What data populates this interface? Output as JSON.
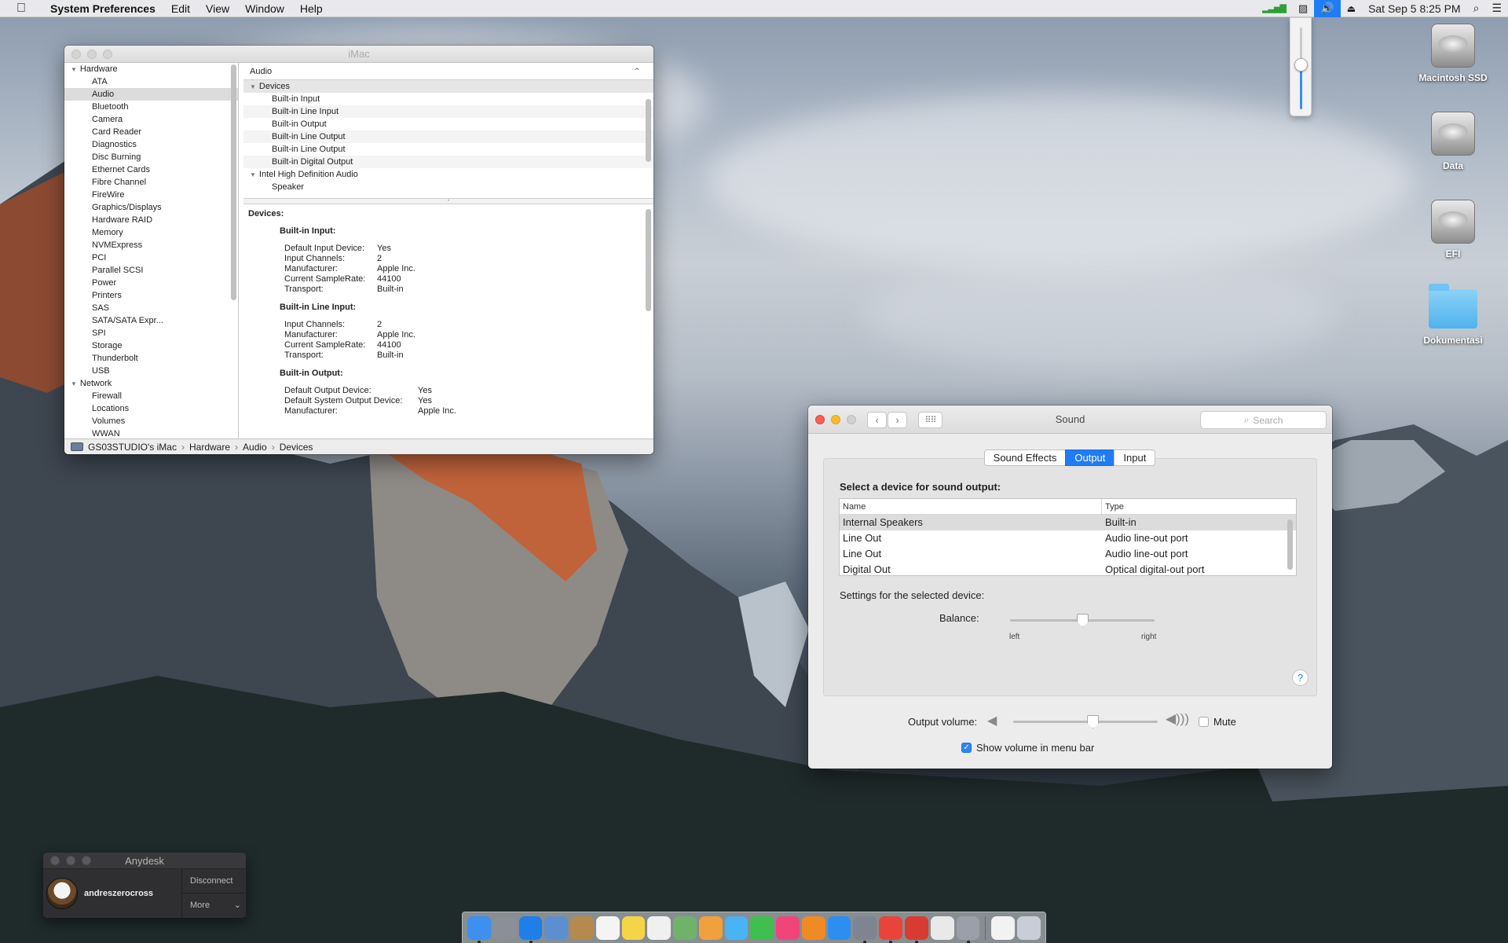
{
  "menubar": {
    "app_name": "System Preferences",
    "menus": [
      "Edit",
      "View",
      "Window",
      "Help"
    ],
    "clock": "Sat Sep 5  8:25 PM",
    "volume_level": 0.55
  },
  "desktop_icons": [
    {
      "label": "Macintosh SSD",
      "kind": "disk"
    },
    {
      "label": "Data",
      "kind": "disk"
    },
    {
      "label": "EFI",
      "kind": "disk"
    },
    {
      "label": "Dokumentasi",
      "kind": "folder"
    }
  ],
  "sysinfo": {
    "title": "iMac",
    "sidebar_hardware_label": "Hardware",
    "sidebar_hardware": [
      "ATA",
      "Audio",
      "Bluetooth",
      "Camera",
      "Card Reader",
      "Diagnostics",
      "Disc Burning",
      "Ethernet Cards",
      "Fibre Channel",
      "FireWire",
      "Graphics/Displays",
      "Hardware RAID",
      "Memory",
      "NVMExpress",
      "PCI",
      "Parallel SCSI",
      "Power",
      "Printers",
      "SAS",
      "SATA/SATA Expr...",
      "SPI",
      "Storage",
      "Thunderbolt",
      "USB"
    ],
    "sidebar_selected": "Audio",
    "sidebar_network_label": "Network",
    "sidebar_network": [
      "Firewall",
      "Locations",
      "Volumes",
      "WWAN"
    ],
    "tree_header": "Audio",
    "tree_group1": "Devices",
    "tree_devices": [
      "Built-in Input",
      "Built-in Line Input",
      "Built-in Output",
      "Built-in Line Output",
      "Built-in Line Output",
      "Built-in Digital Output"
    ],
    "tree_group2": "Intel High Definition Audio",
    "tree_group2_items": [
      "Speaker"
    ],
    "detail": {
      "heading": "Devices:",
      "sections": [
        {
          "title": "Built-in Input:",
          "wide": false,
          "rows": [
            [
              "Default Input Device:",
              "Yes"
            ],
            [
              "Input Channels:",
              "2"
            ],
            [
              "Manufacturer:",
              "Apple Inc."
            ],
            [
              "Current SampleRate:",
              "44100"
            ],
            [
              "Transport:",
              "Built-in"
            ]
          ]
        },
        {
          "title": "Built-in Line Input:",
          "wide": false,
          "rows": [
            [
              "Input Channels:",
              "2"
            ],
            [
              "Manufacturer:",
              "Apple Inc."
            ],
            [
              "Current SampleRate:",
              "44100"
            ],
            [
              "Transport:",
              "Built-in"
            ]
          ]
        },
        {
          "title": "Built-in Output:",
          "wide": true,
          "rows": [
            [
              "Default Output Device:",
              "Yes"
            ],
            [
              "Default System Output Device:",
              "Yes"
            ],
            [
              "Manufacturer:",
              "Apple Inc."
            ]
          ]
        }
      ]
    },
    "path": [
      "GS03STUDIO's iMac",
      "Hardware",
      "Audio",
      "Devices"
    ]
  },
  "sound": {
    "title": "Sound",
    "search_placeholder": "Search",
    "tabs": [
      {
        "label": "Sound Effects",
        "active": false
      },
      {
        "label": "Output",
        "active": true
      },
      {
        "label": "Input",
        "active": false
      }
    ],
    "select_label": "Select a device for sound output:",
    "columns": [
      "Name",
      "Type"
    ],
    "devices": [
      {
        "name": "Internal Speakers",
        "type": "Built-in",
        "selected": true
      },
      {
        "name": "Line Out",
        "type": "Audio line-out port",
        "selected": false
      },
      {
        "name": "Line Out",
        "type": "Audio line-out port",
        "selected": false
      },
      {
        "name": "Digital Out",
        "type": "Optical digital-out port",
        "selected": false
      }
    ],
    "settings_label": "Settings for the selected device:",
    "balance_label": "Balance:",
    "balance_left": "left",
    "balance_right": "right",
    "balance_value": 0.5,
    "output_volume_label": "Output volume:",
    "output_volume_value": 0.55,
    "mute_label": "Mute",
    "mute_checked": false,
    "show_volume_label": "Show volume in menu bar",
    "show_volume_checked": true,
    "help_label": "?"
  },
  "anydesk": {
    "title": "Anydesk",
    "user": "andreszerocross",
    "disconnect_label": "Disconnect",
    "more_label": "More"
  },
  "dock": {
    "apps": [
      {
        "icon": "finder-icon",
        "color": "#3d8ff0",
        "running": true
      },
      {
        "icon": "launchpad-icon",
        "color": "#8a8f98",
        "running": false
      },
      {
        "icon": "safari-icon",
        "color": "#1f7ee8",
        "running": true
      },
      {
        "icon": "preview-icon",
        "color": "#5b8fd0",
        "running": false
      },
      {
        "icon": "contacts-icon",
        "color": "#b68a4e",
        "running": false
      },
      {
        "icon": "calendar-icon",
        "color": "#f4f4f4",
        "running": false
      },
      {
        "icon": "notes-icon",
        "color": "#f5d547",
        "running": false
      },
      {
        "icon": "reminders-icon",
        "color": "#f0f0f0",
        "running": false
      },
      {
        "icon": "maps-icon",
        "color": "#6fb36a",
        "running": false
      },
      {
        "icon": "photos-icon",
        "color": "#f0a03c",
        "running": false
      },
      {
        "icon": "messages-icon",
        "color": "#4ab3f4",
        "running": false
      },
      {
        "icon": "facetime-icon",
        "color": "#3fbf4f",
        "running": false
      },
      {
        "icon": "itunes-icon",
        "color": "#f0447a",
        "running": false
      },
      {
        "icon": "ibooks-icon",
        "color": "#f08a24",
        "running": false
      },
      {
        "icon": "app-store-icon",
        "color": "#2b8ef0",
        "running": false
      },
      {
        "icon": "system-preferences-icon",
        "color": "#7e8590",
        "running": true
      },
      {
        "icon": "anydesk-icon",
        "color": "#e8443a",
        "running": true
      },
      {
        "icon": "anydesk-alt-icon",
        "color": "#d93a31",
        "running": true
      },
      {
        "icon": "textedit-icon",
        "color": "#e9e9e9",
        "running": false
      },
      {
        "icon": "system-information-icon",
        "color": "#9aa0a8",
        "running": true
      },
      {
        "icon": "document-icon",
        "color": "#f2f2f2",
        "running": false
      },
      {
        "icon": "trash-icon",
        "color": "#c9ced6",
        "running": false
      }
    ]
  }
}
